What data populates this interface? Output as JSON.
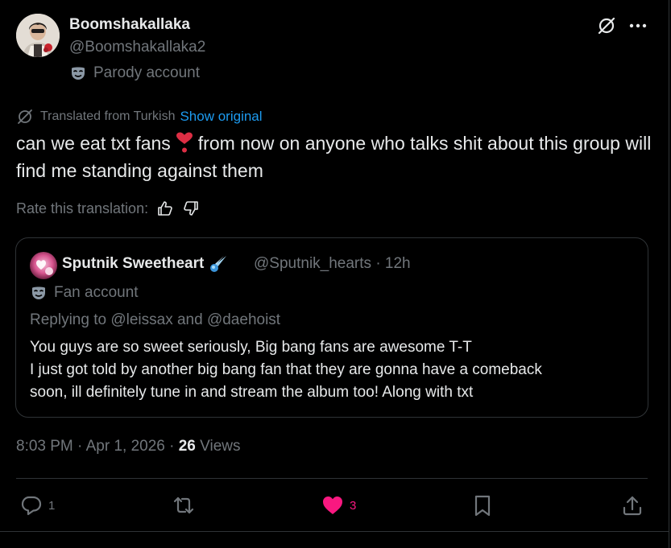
{
  "author": {
    "display_name": "Boomshakallaka",
    "handle": "@Boomshakallaka2",
    "account_label": "Parody account",
    "label_icon": "mask-icon"
  },
  "translation": {
    "notice": "Translated from Turkish",
    "show_original_label": "Show original",
    "rate_label": "Rate this translation:"
  },
  "tweet": {
    "text_before_emoji": "can we eat txt fans",
    "emoji": "heart-exclamation",
    "text_after_emoji": "from now on anyone who talks shit about this group will find me standing against them"
  },
  "quote": {
    "display_name": "Sputnik Sweetheart",
    "badge_emoji": "comet",
    "handle_time": "@Sputnik_hearts · 12h",
    "account_label": "Fan account",
    "replying_to": "Replying to @leissax and @daehoist",
    "lines": [
      "You guys are so sweet seriously, Big bang fans are awesome T-T",
      "I just got told by another big bang fan that they are gonna have a comeback",
      "soon, ill definitely tune in and stream the album too! Along with txt"
    ]
  },
  "meta": {
    "timestamp": "8:03 PM · Apr 1, 2026 · ",
    "views_count": "26",
    "views_label": " Views"
  },
  "actions": {
    "replies": "1",
    "reposts": "",
    "likes": "3",
    "like_color": "#f91880"
  },
  "colors": {
    "background": "#000000",
    "text_primary": "#e7e9ea",
    "text_secondary": "#71767b",
    "link": "#1d9bf0",
    "border": "#2f3336"
  }
}
